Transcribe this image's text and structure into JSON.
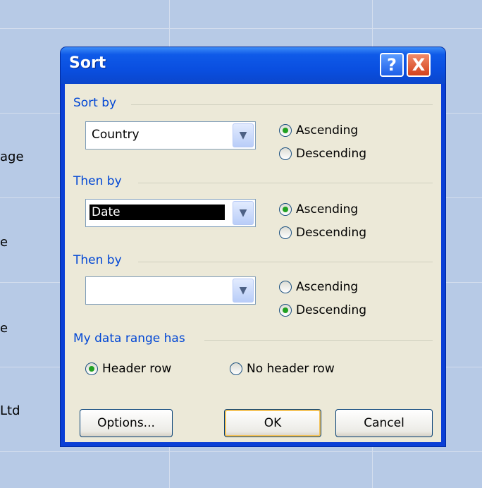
{
  "background": {
    "cell_texts": [
      "age",
      "e",
      "e",
      "Ltd"
    ]
  },
  "dialog": {
    "title": "Sort",
    "help_label": "?",
    "close_label": "X",
    "sort_by": {
      "label": "Sort by",
      "value": "Country",
      "ascending": "Ascending",
      "descending": "Descending",
      "selected": "ascending"
    },
    "then_by_1": {
      "label": "Then by",
      "value": "Date",
      "ascending": "Ascending",
      "descending": "Descending",
      "selected": "ascending"
    },
    "then_by_2": {
      "label": "Then by",
      "value": "",
      "ascending": "Ascending",
      "descending": "Descending",
      "selected": "descending"
    },
    "data_range": {
      "label": "My data range has",
      "header_row": "Header row",
      "no_header_row": "No header row",
      "selected": "header_row"
    },
    "buttons": {
      "options": "Options...",
      "ok": "OK",
      "cancel": "Cancel"
    }
  },
  "colors": {
    "title_bar": "#0a4fe0",
    "group_label": "#0046d5",
    "dialog_face": "#ece9d8",
    "sheet_background": "#b7cae6"
  }
}
